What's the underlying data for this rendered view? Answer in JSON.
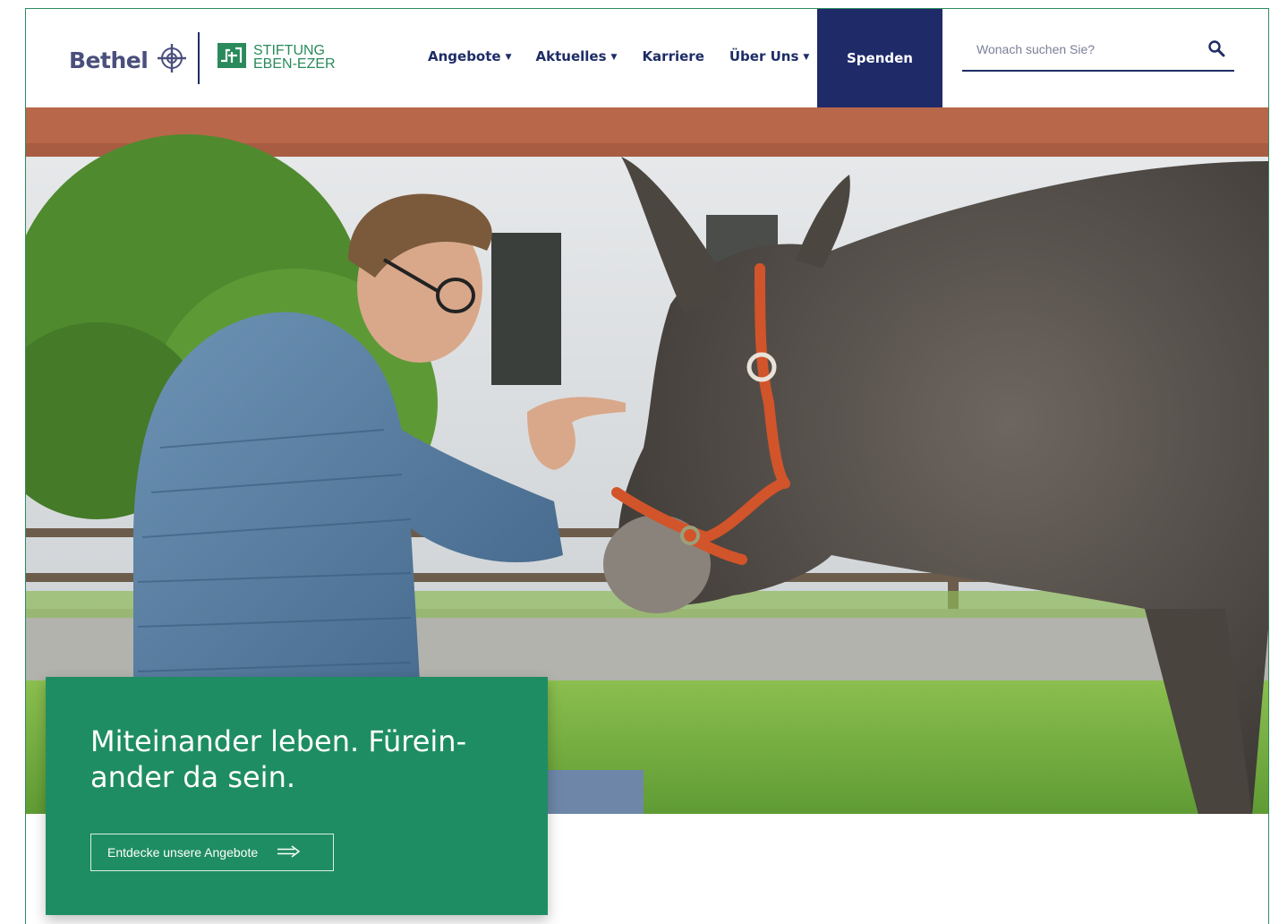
{
  "brand": {
    "bethel_wordmark": "Bethel",
    "stiftung_line1": "STIFTUNG",
    "stiftung_line2": "EBEN-EZER",
    "brand_green": "#1f8d63",
    "brand_navy": "#1f2a69"
  },
  "nav": {
    "items": [
      {
        "label": "Angebote",
        "has_dropdown": true
      },
      {
        "label": "Aktuelles",
        "has_dropdown": true
      },
      {
        "label": "Karriere",
        "has_dropdown": false
      },
      {
        "label": "Über Uns",
        "has_dropdown": true
      }
    ],
    "donate_label": "Spenden"
  },
  "search": {
    "placeholder": "Wonach suchen Sie?",
    "value": "",
    "icon": "search-icon"
  },
  "hero": {
    "image_description_icon": "hero-photo"
  },
  "callout": {
    "title_line1": "Miteinander leben. Fürein-",
    "title_line2": "ander da sein.",
    "cta_label": "Entdecke unsere Angebote",
    "cta_icon": "arrow-right-icon"
  }
}
